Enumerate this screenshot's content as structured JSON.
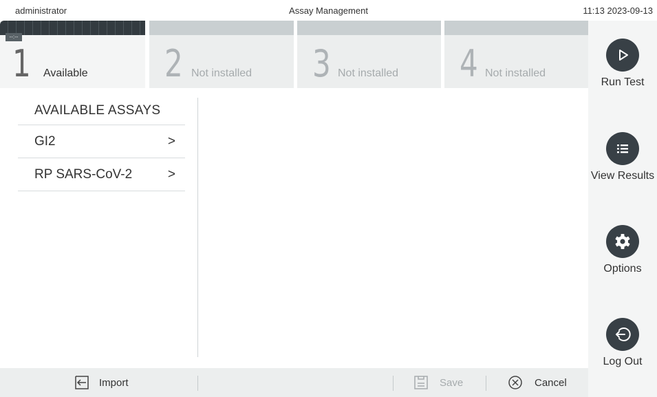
{
  "header": {
    "user": "administrator",
    "title": "Assay Management",
    "datetime": "11:13 2023-09-13"
  },
  "modules": [
    {
      "number": "1",
      "status": "Available",
      "tag": "--:--",
      "active": true
    },
    {
      "number": "2",
      "status": "Not installed",
      "active": false
    },
    {
      "number": "3",
      "status": "Not installed",
      "active": false
    },
    {
      "number": "4",
      "status": "Not installed",
      "active": false
    }
  ],
  "assays": {
    "heading": "AVAILABLE ASSAYS",
    "items": [
      {
        "name": "GI2",
        "chevron": ">"
      },
      {
        "name": "RP SARS-CoV-2",
        "chevron": ">"
      }
    ]
  },
  "sidebar": {
    "run_test": "Run Test",
    "view_results": "View Results",
    "options": "Options",
    "log_out": "Log Out"
  },
  "footer": {
    "import": "Import",
    "save": "Save",
    "cancel": "Cancel"
  },
  "colors": {
    "sidebar_icon_bg": "#384046",
    "active_strip": "#333b40",
    "disabled_text": "#a6abad"
  }
}
